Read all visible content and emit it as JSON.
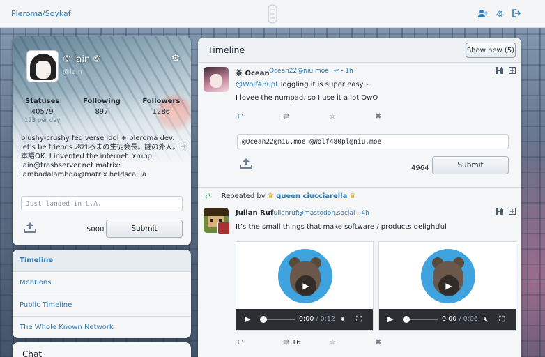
{
  "topbar": {
    "brand": "Pleroma/Soykaf",
    "icons": [
      "user-plus-icon",
      "gear-icon",
      "logout-icon"
    ]
  },
  "profile": {
    "display_name": "⑨ lain ⑨",
    "handle": "@lain",
    "stats": [
      {
        "label": "Statuses",
        "value": "40579",
        "sub": "123 per day"
      },
      {
        "label": "Following",
        "value": "897",
        "sub": ""
      },
      {
        "label": "Followers",
        "value": "1286",
        "sub": ""
      }
    ],
    "bio": "blushy-crushy fediverse idol + pleroma dev. let's be friends ぷれろまの生徒会長。謎の外人。日本語OK. I invented the internet. xmpp: lain@trashserver.net matrix: lambadalambda@matrix.heldscal.la",
    "compose_placeholder": "Just landed in L.A.",
    "char_count": "5000",
    "submit_label": "Submit"
  },
  "nav": {
    "items": [
      {
        "label": "Timeline",
        "active": true
      },
      {
        "label": "Mentions",
        "active": false
      },
      {
        "label": "Public Timeline",
        "active": false
      },
      {
        "label": "The Whole Known Network",
        "active": false
      }
    ]
  },
  "chat": {
    "title": "Chat"
  },
  "timeline": {
    "title": "Timeline",
    "show_new": "Show new (5)",
    "status1": {
      "name": "茶 Ocean",
      "handle": "Ocean22@niu.moe",
      "time": "1h",
      "mention": "@Wolf480pl",
      "text1": " Toggling it is super easy~",
      "text2": "I lovee the numpad, so I use it a lot OwO",
      "reply_value": "@Ocean22@niu.moe @Wolf480pl@niu.moe",
      "reply_count": "4964",
      "submit_label": "Submit"
    },
    "repeat": {
      "label": "Repeated by",
      "who": "queen ciucciarella"
    },
    "status2": {
      "name": "Julian Ruf",
      "handle": "julianruf@mastodon.social",
      "time": "4h",
      "text": "It’s the small things that make software / products delightful",
      "videos": [
        {
          "current": "0:00",
          "duration": "/ 0:12"
        },
        {
          "current": "0:00",
          "duration": "/ 0:06"
        }
      ],
      "repeat_count": "16"
    }
  }
}
